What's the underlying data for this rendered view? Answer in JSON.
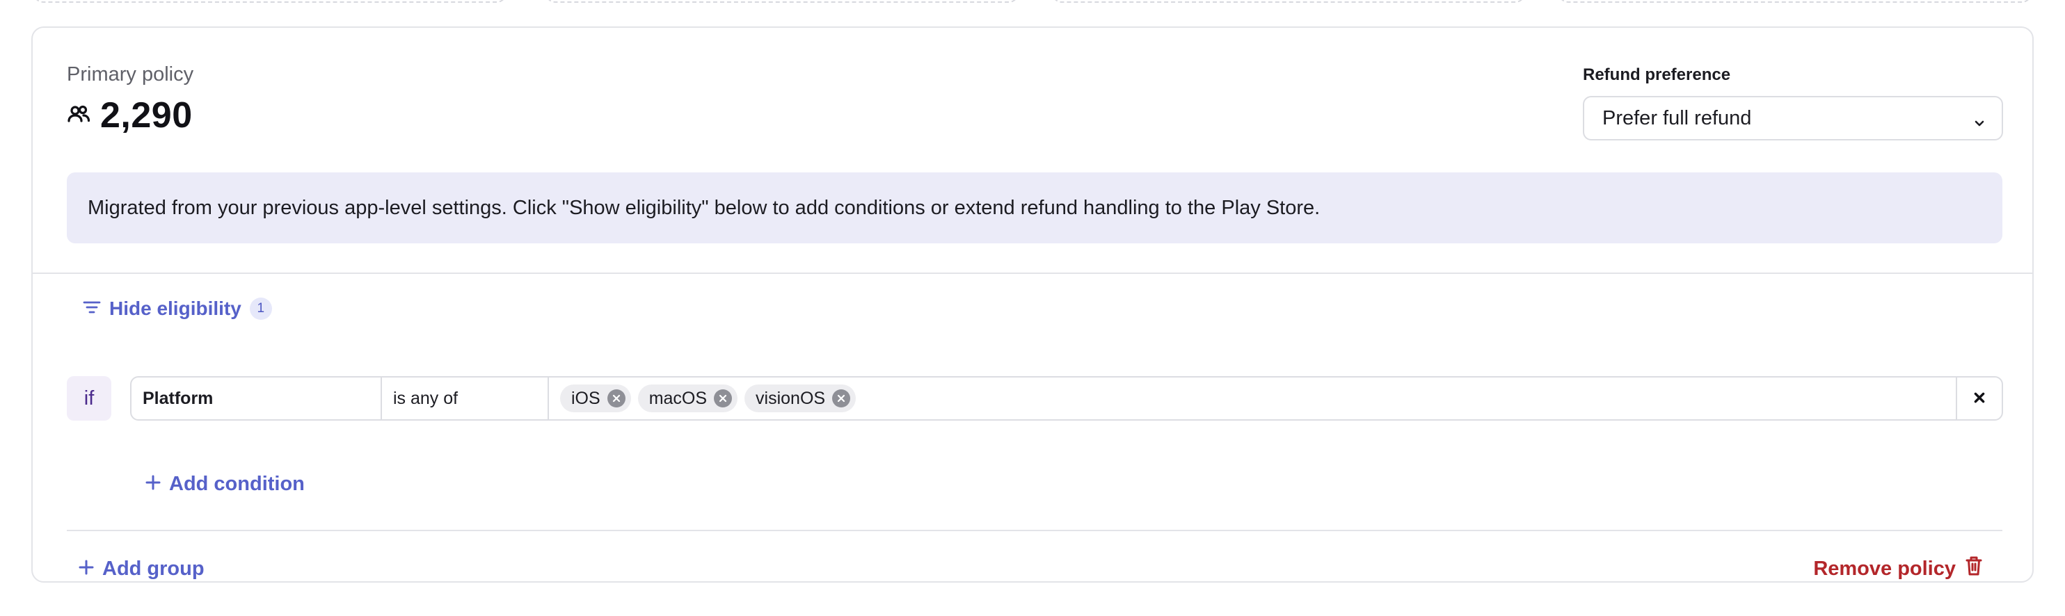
{
  "policy": {
    "title": "Primary policy",
    "count": "2,290",
    "count_icon": "users-icon"
  },
  "refund": {
    "label": "Refund preference",
    "selected": "Prefer full refund"
  },
  "banner": {
    "text": "Migrated from your previous app-level settings. Click \"Show eligibility\" below to add conditions or extend refund handling to the Play Store."
  },
  "eligibility": {
    "toggle_label": "Hide eligibility",
    "count_badge": "1",
    "if_label": "if",
    "condition": {
      "field": "Platform",
      "operator": "is any of",
      "values": [
        "iOS",
        "macOS",
        "visionOS"
      ]
    },
    "add_condition_label": "Add condition"
  },
  "footer": {
    "add_group_label": "Add group",
    "remove_policy_label": "Remove policy"
  },
  "colors": {
    "accent": "#5661c9",
    "danger": "#b3262a",
    "banner_bg": "#ebebf8"
  }
}
